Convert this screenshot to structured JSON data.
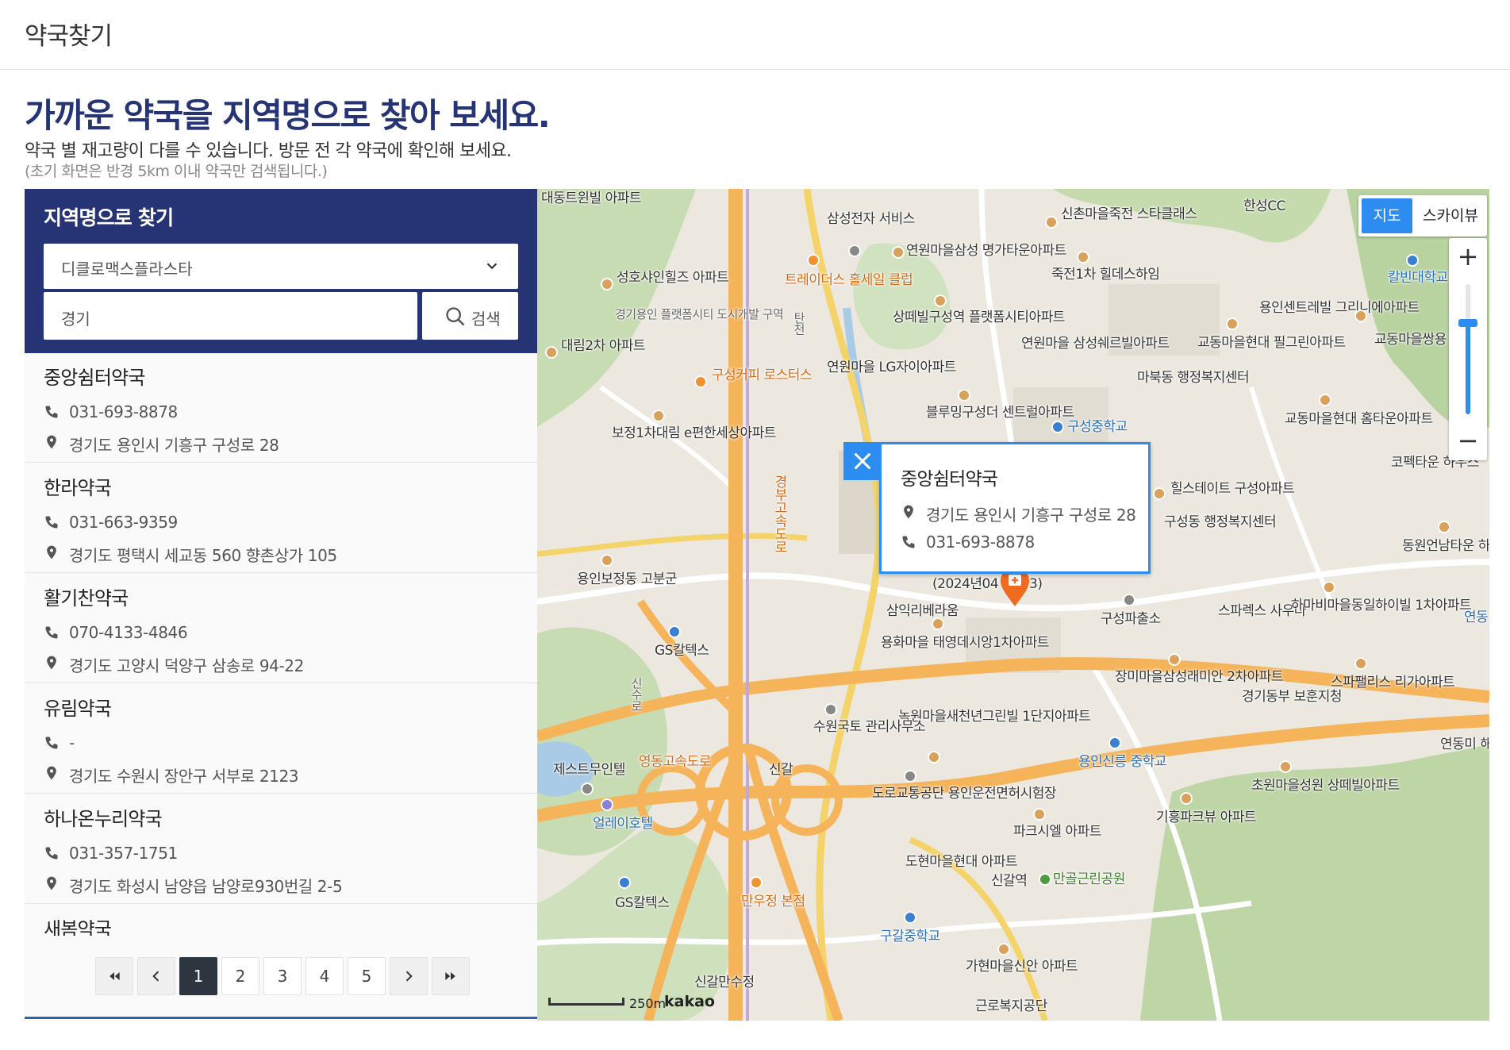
{
  "header": {
    "title": "약국찾기"
  },
  "intro": {
    "headline": "가까운 약국을 지역명으로 찾아 보세요.",
    "subline": "약국 별 재고량이 다를 수 있습니다. 방문 전 각 약국에 확인해 보세요.",
    "note": "(초기 화면은 반경 5km 이내 약국만 검색됩니다.)"
  },
  "search": {
    "label": "지역명으로 찾기",
    "product_select": "디클로맥스플라스타",
    "region_input": "경기",
    "button_label": "검색"
  },
  "pharmacies": [
    {
      "name": "중앙쉼터약국",
      "phone": "031-693-8878",
      "address": "경기도 용인시 기흥구 구성로 28"
    },
    {
      "name": "한라약국",
      "phone": "031-663-9359",
      "address": "경기도 평택시 세교동 560 향촌상가 105"
    },
    {
      "name": "활기찬약국",
      "phone": "070-4133-4846",
      "address": "경기도 고양시 덕양구 삼송로 94-22"
    },
    {
      "name": "유림약국",
      "phone": "-",
      "address": "경기도 수원시 장안구 서부로 2123"
    },
    {
      "name": "하나온누리약국",
      "phone": "031-357-1751",
      "address": "경기도 화성시 남양읍 남양로930번길 2-5"
    },
    {
      "name": "새봄약국",
      "phone": "",
      "address": ""
    }
  ],
  "pagination": {
    "pages": [
      "1",
      "2",
      "3",
      "4",
      "5"
    ],
    "current": "1"
  },
  "map": {
    "type_map": "지도",
    "type_sky": "스카이뷰",
    "zoom_in": "+",
    "zoom_out": "−",
    "scale": "250m",
    "provider": "kakao",
    "popup": {
      "name": "중앙쉼터약국",
      "address": "경기도 용인시 기흥구 구성로 28",
      "phone": "031-693-8878"
    },
    "labels": [
      "대동트윈빌 아파트",
      "삼성전자 서비스",
      "연원마을삼성 명가타운아파트",
      "신촌마을죽전 스타클래스",
      "한성CC",
      "칼빈대학교",
      "성호샤인힐즈 아파트",
      "트레이더스 홀세일 클럽",
      "죽전1차 힐데스하임",
      "용인센트레빌 그리니에아파트",
      "경기용인 플랫폼시티 도시개발 구역",
      "상떼빌구성역 플랫폼시티아파트",
      "교동마을현대 필그린아파트",
      "교동마을쌍용 아파트",
      "대림2차 아파트",
      "연원마을 삼성쉐르빌아파트",
      "연원마을 LG자이아파트",
      "구성커피 로스터스",
      "마북동 행정복지센터",
      "블루밍구성더 센트럴아파트",
      "보정1차대림 e편한세상아파트",
      "구성중학교",
      "교동마을현대 홈타운아파트",
      "코펙타운 하우스",
      "힐스테이트 구성아파트",
      "경부고속도로",
      "구성동 행정복지센터",
      "동원언남타운 하우스",
      "용인보정동 고분군",
      "(2024년04",
      "3)",
      "삼익리베라움",
      "구성파출소",
      "스파렉스 사우나",
      "하마비마을동일하이빌 1차아파트",
      "GS칼텍스",
      "용화마을 태영데시앙1차아파트",
      "장미마을삼성래미안 2차아파트",
      "스파팰리스 리가아파트",
      "경기동부 보훈지청",
      "신수로",
      "녹원마을새천년그린빌 1단지아파트",
      "수원국토 관리사무소",
      "용인신릉 중학교",
      "영동고속도로",
      "제스트무인텔",
      "신갈",
      "도로교통공단 용인운전면허시험장",
      "초원마을성원 상떼빌아파트",
      "얼레이호텔",
      "파크시엘 아파트",
      "기흥파크뷰 아파트",
      "도현마을현대 아파트",
      "신갈역",
      "만골근린공원",
      "만우정 본점",
      "구갈중학교",
      "가현마을신안 아파트",
      "신갈만수정",
      "근로복지공단",
      "연동",
      "연동미 해피트리",
      "탄천"
    ]
  }
}
